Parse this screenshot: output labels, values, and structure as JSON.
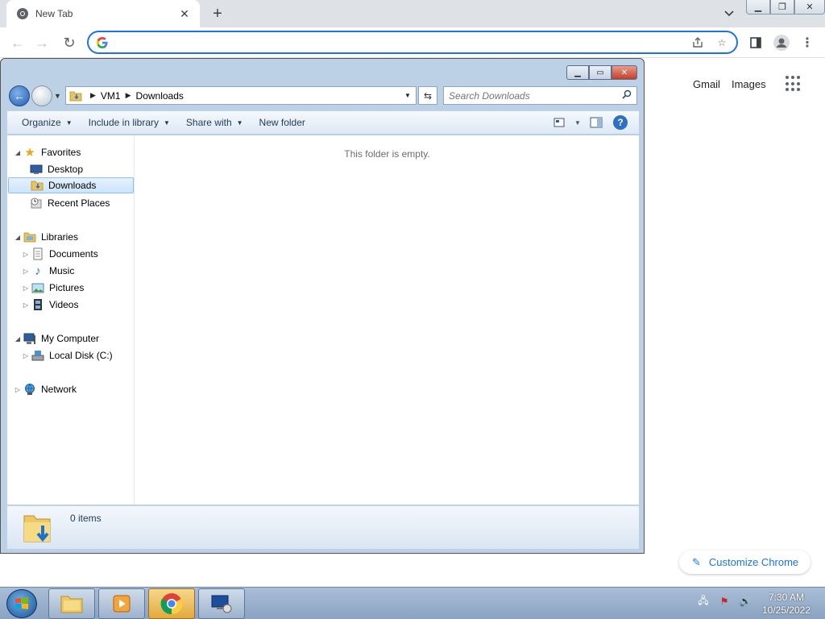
{
  "browser": {
    "tab_title": "New Tab",
    "omnibox_value": "",
    "links": {
      "gmail": "Gmail",
      "images": "Images"
    },
    "customize_label": "Customize Chrome",
    "accent": "#1a73e8"
  },
  "explorer": {
    "breadcrumb": [
      "VM1",
      "Downloads"
    ],
    "search_placeholder": "Search Downloads",
    "commands": {
      "organize": "Organize",
      "include": "Include in library",
      "share": "Share with",
      "new_folder": "New folder"
    },
    "tree": {
      "favorites": "Favorites",
      "desktop": "Desktop",
      "downloads": "Downloads",
      "recent": "Recent Places",
      "libraries": "Libraries",
      "documents": "Documents",
      "music": "Music",
      "pictures": "Pictures",
      "videos": "Videos",
      "computer": "My Computer",
      "local_disk": "Local Disk (C:)",
      "network": "Network"
    },
    "empty_message": "This folder is empty.",
    "item_count": "0 items"
  },
  "taskbar": {
    "time": "7:30 AM",
    "date": "10/25/2022"
  }
}
